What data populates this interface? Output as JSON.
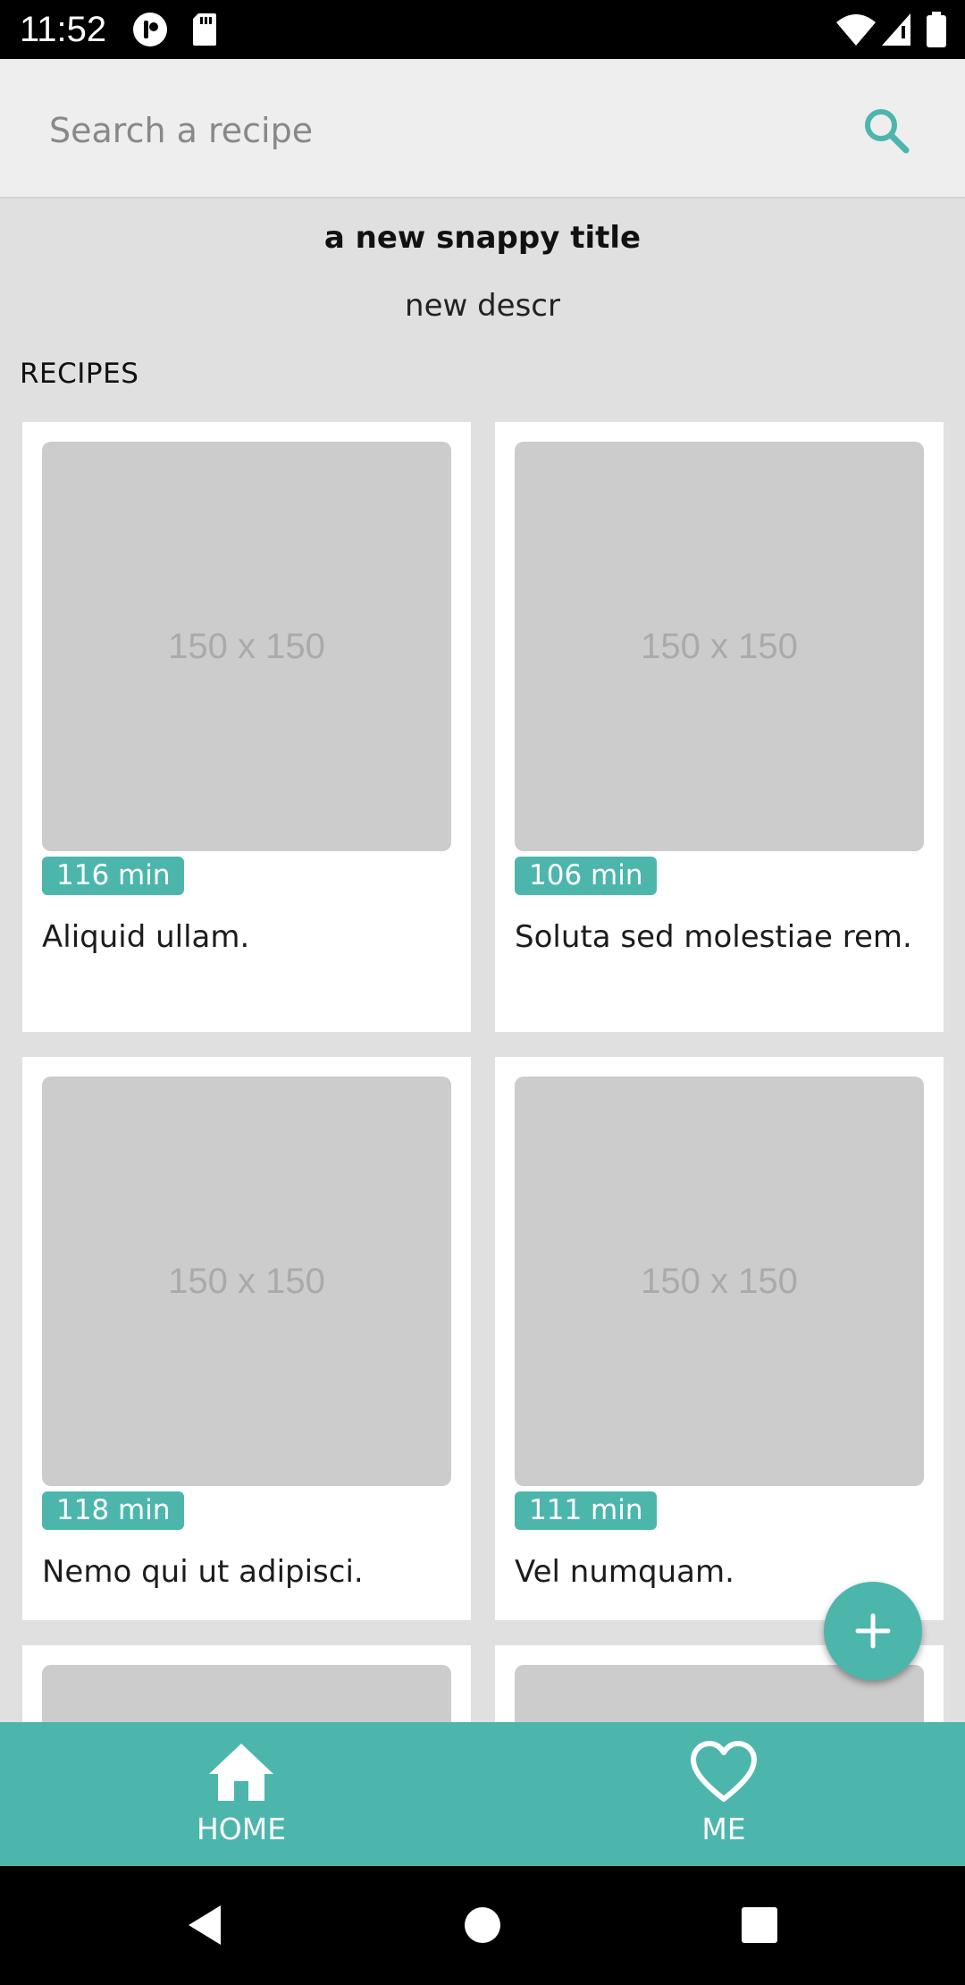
{
  "status_bar": {
    "time": "11:52",
    "icons": [
      "app-notification-icon",
      "sd-card-icon",
      "wifi-icon",
      "signal-icon",
      "battery-icon"
    ]
  },
  "search": {
    "placeholder": "Search a recipe",
    "icon": "search-icon"
  },
  "header": {
    "title": "a new snappy title",
    "description": "new descr"
  },
  "recipes": {
    "section_label": "RECIPES",
    "items": [
      {
        "image_label": "150 x 150",
        "time": "116 min",
        "title": "Aliquid ullam."
      },
      {
        "image_label": "150 x 150",
        "time": "106 min",
        "title": "Soluta sed molestiae rem."
      },
      {
        "image_label": "150 x 150",
        "time": "118 min",
        "title": "Nemo qui ut adipisci."
      },
      {
        "image_label": "150 x 150",
        "time": "111 min",
        "title": "Vel numquam."
      }
    ]
  },
  "fab": {
    "icon": "plus-icon"
  },
  "bottom_nav": {
    "items": [
      {
        "label": "HOME",
        "icon": "home-icon"
      },
      {
        "label": "ME",
        "icon": "heart-icon"
      }
    ]
  },
  "colors": {
    "accent": "#4db6ac",
    "background": "#e0e0e0",
    "card": "#ffffff",
    "placeholder": "#cccccc"
  }
}
